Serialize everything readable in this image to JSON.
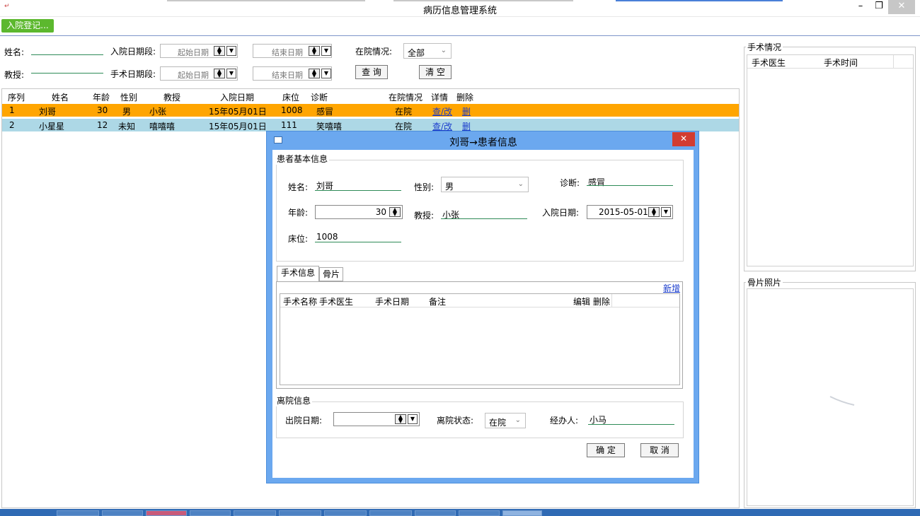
{
  "window": {
    "title": "病历信息管理系统",
    "min": "–",
    "max": "❐",
    "close": "✕"
  },
  "toolbar": {
    "admit_label": "入院登记..."
  },
  "filters": {
    "name_label": "姓名:",
    "admit_period_label": "入院日期段:",
    "start_date_placeholder": "起始日期",
    "end_date_placeholder": "结束日期",
    "status_label": "在院情况:",
    "status_value": "全部",
    "professor_label": "教授:",
    "surgery_period_label": "手术日期段:",
    "query_label": "查 询",
    "clear_label": "清 空"
  },
  "grid": {
    "headers": [
      "序列",
      "姓名",
      "年龄",
      "性别",
      "教授",
      "入院日期",
      "床位",
      "诊断",
      "在院情况",
      "详情",
      "删除"
    ],
    "rows": [
      {
        "seq": "1",
        "name": "刘哥",
        "age": "30",
        "sex": "男",
        "prof": "小张",
        "date": "15年05月01日",
        "bed": "1008",
        "diag": "感冒",
        "status": "在院",
        "detail": "查/改",
        "del": "删",
        "color": "#ffa500"
      },
      {
        "seq": "2",
        "name": "小星星",
        "age": "12",
        "sex": "未知",
        "prof": "嘻嘻嘻",
        "date": "15年05月01日",
        "bed": "111",
        "diag": "笑嘻嘻",
        "status": "在院",
        "detail": "查/改",
        "del": "删",
        "color": "#add8e6"
      }
    ]
  },
  "surgery_panel": {
    "title": "手术情况",
    "col1": "手术医生",
    "col2": "手术时间"
  },
  "photo_panel": {
    "title": "骨片照片"
  },
  "dialog": {
    "title": "刘哥→患者信息",
    "close": "✕",
    "basic_group": "患者基本信息",
    "name_label": "姓名:",
    "name_value": "刘哥",
    "sex_label": "性别:",
    "sex_value": "男",
    "diag_label": "诊断:",
    "diag_value": "感冒",
    "age_label": "年龄:",
    "age_value": "30",
    "prof_label": "教授:",
    "prof_value": "小张",
    "admit_label": "入院日期:",
    "admit_value": "2015-05-01",
    "bed_label": "床位:",
    "bed_value": "1008",
    "tabs": [
      "手术信息",
      "骨片"
    ],
    "add_label": "新增",
    "surgery_headers": [
      "手术名称",
      "手术医生",
      "手术日期",
      "备注",
      "编辑",
      "删除"
    ],
    "discharge_group": "离院信息",
    "discharge_date_label": "出院日期:",
    "discharge_status_label": "离院状态:",
    "discharge_status_value": "在院",
    "handler_label": "经办人:",
    "handler_value": "小马",
    "ok_label": "确 定",
    "cancel_label": "取 消"
  },
  "colors": {
    "accent_green": "#5cb82e",
    "dialog_blue": "#6ba8ef",
    "row_selected": "#ffa500",
    "row_alt": "#add8e6"
  }
}
